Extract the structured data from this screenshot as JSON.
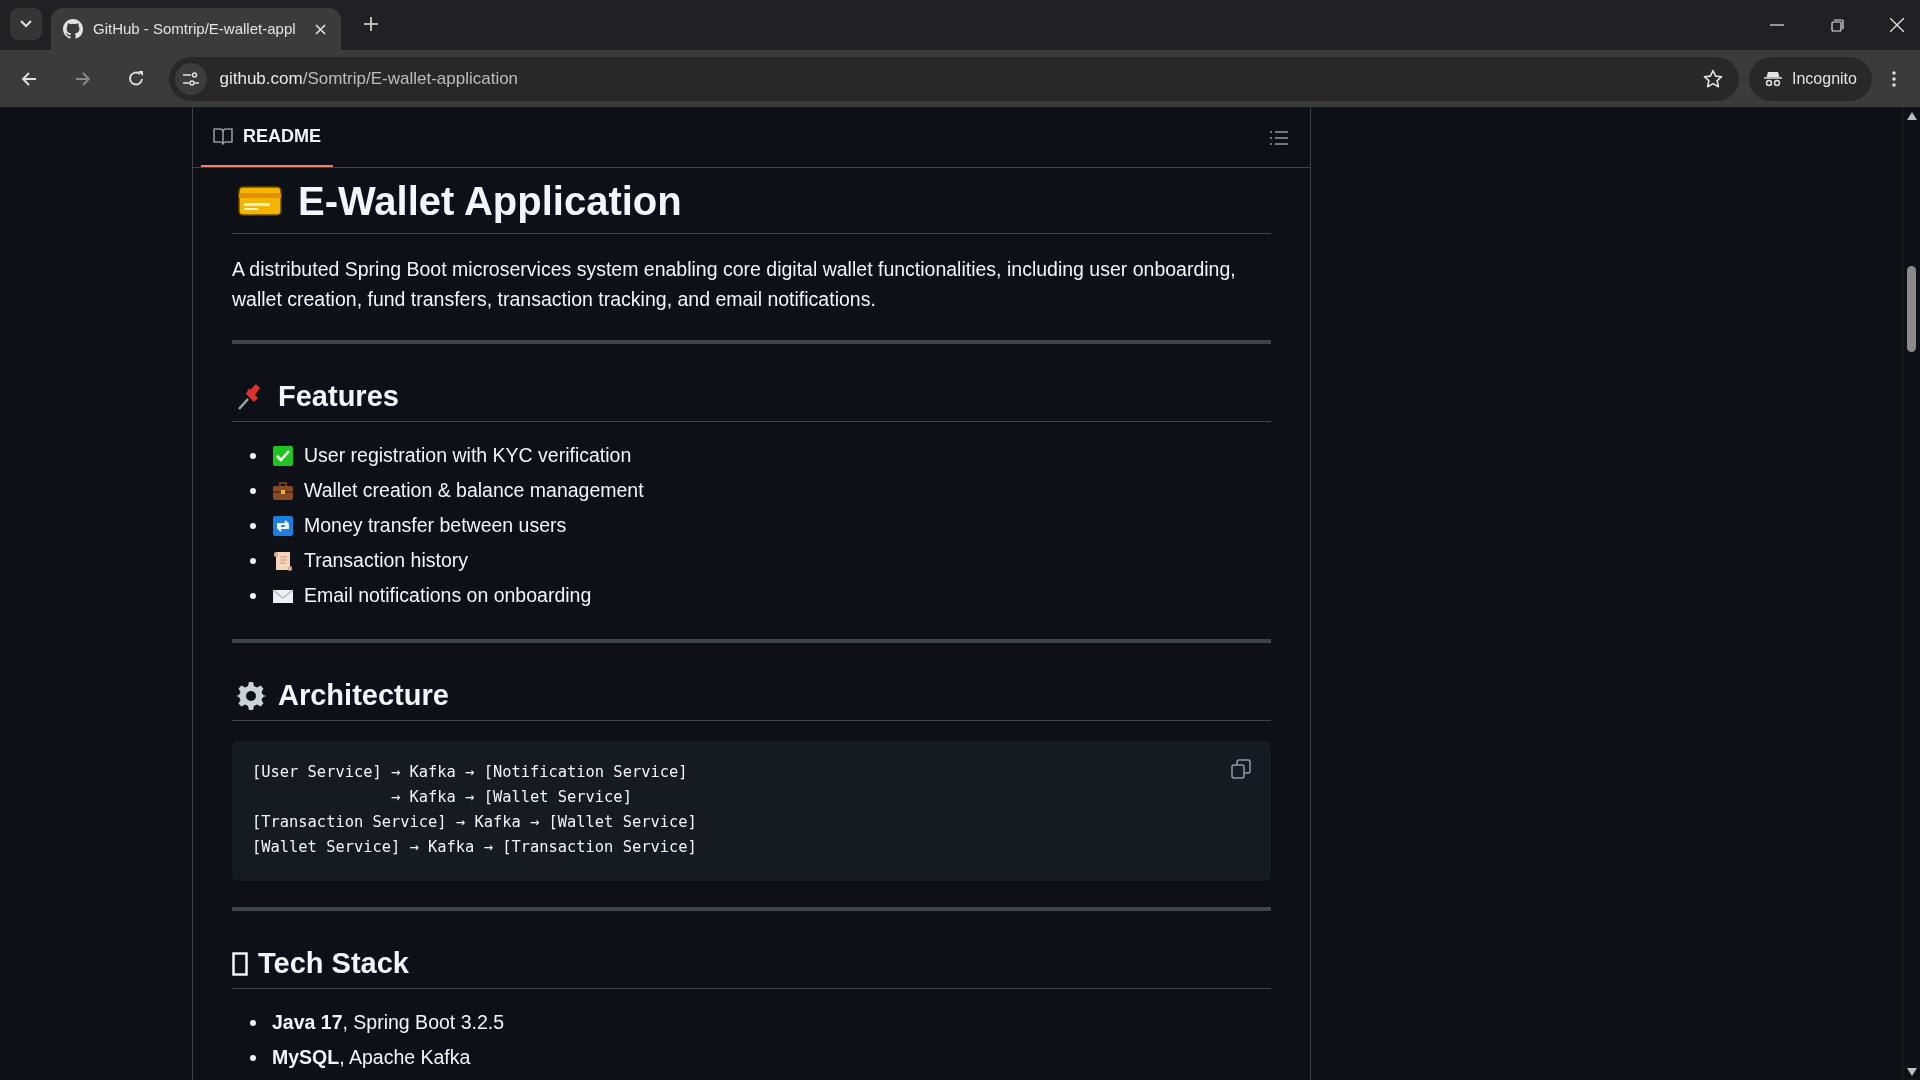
{
  "browser": {
    "tab_title": "GitHub - Somtrip/E-wallet-appl",
    "url": {
      "host": "github.com",
      "path": "/Somtrip/E-wallet-application"
    },
    "incognito": "Incognito"
  },
  "readme": {
    "tab": "README",
    "title": "E-Wallet Application",
    "description": "A distributed Spring Boot microservices system enabling core digital wallet functionalities, including user onboarding, wallet creation, fund transfers, transaction tracking, and email notifications.",
    "sections": [
      {
        "heading": "Features",
        "kind": "pin",
        "items": [
          {
            "kind": "check",
            "text": "User registration with KYC verification"
          },
          {
            "kind": "briefcase",
            "text": "Wallet creation & balance management"
          },
          {
            "kind": "repeat",
            "text": "Money transfer between users"
          },
          {
            "kind": "scroll",
            "text": "Transaction history"
          },
          {
            "kind": "envelope",
            "text": "Email notifications on onboarding"
          }
        ]
      },
      {
        "heading": "Architecture",
        "kind": "gear",
        "code": [
          "[User Service] → Kafka → [Notification Service]",
          "               → Kafka → [Wallet Service]",
          "[Transaction Service] → Kafka → [Wallet Service]",
          "[Wallet Service] → Kafka → [Transaction Service]"
        ]
      },
      {
        "heading": "Tech Stack",
        "kind": "missing",
        "items": [
          {
            "text": "**Java 17**, Spring Boot 3.2.5"
          },
          {
            "text": "**MySQL**, Apache Kafka"
          }
        ]
      }
    ]
  }
}
